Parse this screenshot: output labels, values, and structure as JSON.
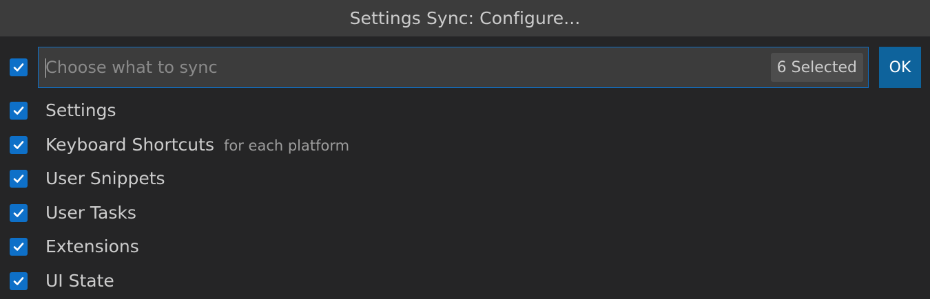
{
  "title": "Settings Sync: Configure...",
  "input": {
    "placeholder": "Choose what to sync",
    "value": "",
    "selected_count": "6 Selected",
    "select_all_checked": true
  },
  "ok_label": "OK",
  "items": [
    {
      "label": "Settings",
      "description": "",
      "checked": true
    },
    {
      "label": "Keyboard Shortcuts",
      "description": "for each platform",
      "checked": true
    },
    {
      "label": "User Snippets",
      "description": "",
      "checked": true
    },
    {
      "label": "User Tasks",
      "description": "",
      "checked": true
    },
    {
      "label": "Extensions",
      "description": "",
      "checked": true
    },
    {
      "label": "UI State",
      "description": "",
      "checked": true
    }
  ],
  "colors": {
    "accent": "#0e70c8",
    "button": "#0e639c",
    "background": "#252526",
    "titlebar": "#3c3c3c"
  }
}
